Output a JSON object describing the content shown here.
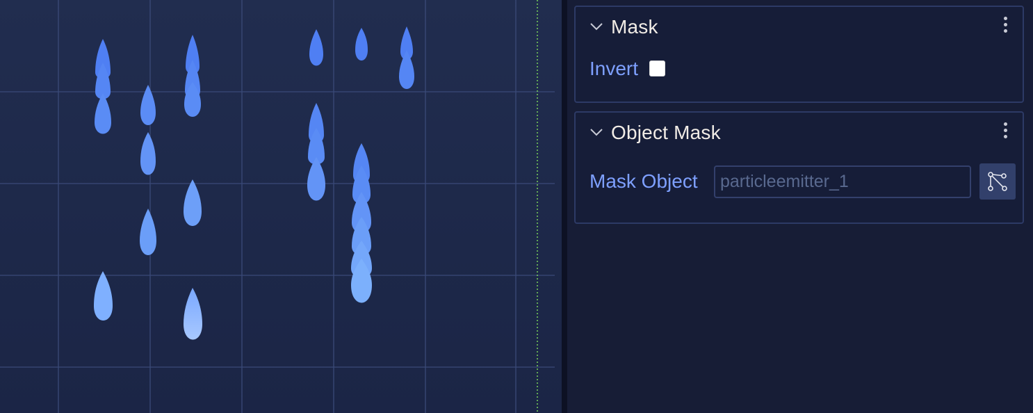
{
  "viewport": {
    "particle_color": "#5f8df6",
    "grid_color": "#3b4a78",
    "boundary_color": "#7bd35a"
  },
  "inspector": {
    "mask_section": {
      "title": "Mask",
      "invert_label": "Invert",
      "invert_checked": false
    },
    "object_mask_section": {
      "title": "Object Mask",
      "mask_object_label": "Mask Object",
      "mask_object_placeholder": "particleemitter_1",
      "mask_object_value": ""
    }
  }
}
